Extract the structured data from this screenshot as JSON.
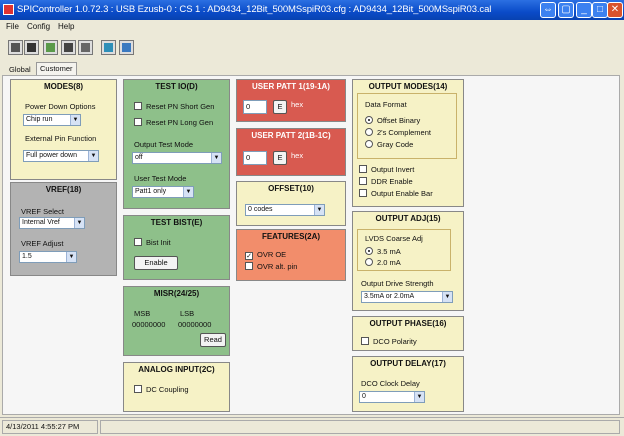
{
  "window": {
    "title": "SPIController 1.0.72.3 : USB Ezusb-0 : CS 1 : AD9434_12Bit_500MSspiR03.cfg : AD9434_12Bit_500MSspiR03.cal"
  },
  "menu": {
    "file": "File",
    "config": "Config",
    "help": "Help"
  },
  "tabs": {
    "global": "Global",
    "customer": "Customer"
  },
  "modes": {
    "title": "MODES(8)",
    "power_down_label": "Power Down Options",
    "power_down_value": "Chip run",
    "ext_pin_label": "External Pin Function",
    "ext_pin_value": "Full power down"
  },
  "vref": {
    "title": "VREF(18)",
    "select_label": "VREF Select",
    "select_value": "Internal Vref",
    "adjust_label": "VREF Adjust",
    "adjust_value": "1.5"
  },
  "test_io": {
    "title": "TEST IO(D)",
    "reset_short": "Reset PN Short Gen",
    "reset_long": "Reset PN Long Gen",
    "output_mode_label": "Output Test Mode",
    "output_mode_value": "off",
    "user_mode_label": "User Test Mode",
    "user_mode_value": "Patt1 only"
  },
  "test_bist": {
    "title": "TEST BIST(E)",
    "bist_init": "Bist Init",
    "enable": "Enable"
  },
  "misr": {
    "title": "MISR(24/25)",
    "msb_label": "MSB",
    "lsb_label": "LSB",
    "msb_value": "00000000",
    "lsb_value": "00000000",
    "read": "Read"
  },
  "analog_input": {
    "title": "ANALOG INPUT(2C)",
    "dc_coupling": "DC Coupling"
  },
  "user_patt1": {
    "title": "USER PATT 1(19-1A)",
    "value": "0",
    "e_btn": "E",
    "unit": "hex"
  },
  "user_patt2": {
    "title": "USER PATT 2(1B-1C)",
    "value": "0",
    "e_btn": "E",
    "unit": "hex"
  },
  "offset": {
    "title": "OFFSET(10)",
    "value": "0 codes"
  },
  "features": {
    "title": "FEATURES(2A)",
    "ovr_oe": "OVR OE",
    "ovr_alt": "OVR alt. pin"
  },
  "output_modes": {
    "title": "OUTPUT MODES(14)",
    "data_format_label": "Data Format",
    "offset_binary": "Offset Binary",
    "twos_complement": "2's Complement",
    "gray_code": "Gray Code",
    "output_invert": "Output Invert",
    "ddr_enable": "DDR Enable",
    "output_enable_bar": "Output Enable Bar"
  },
  "output_adj": {
    "title": "OUTPUT ADJ(15)",
    "lvds_label": "LVDS Coarse Adj",
    "opt_35": "3.5 mA",
    "opt_20": "2.0 mA",
    "drive_label": "Output Drive Strength",
    "drive_value": "3.5mA or 2.0mA"
  },
  "output_phase": {
    "title": "OUTPUT PHASE(16)",
    "dco_polarity": "DCO Polarity"
  },
  "output_delay": {
    "title": "OUTPUT DELAY(17)",
    "dco_delay_label": "DCO Clock Delay",
    "dco_delay_value": "0"
  },
  "status": {
    "timestamp": "4/13/2011 4:55:27 PM"
  },
  "colors": {
    "modes_bg": "#f6f2c6",
    "vref_bg": "#b3b3b3",
    "testio_bg": "#8ec08a",
    "user_patt_bg": "#d85a50",
    "offset_bg": "#f6f2c6",
    "features_bg": "#f28d6b",
    "output_bg": "#f6f2c6",
    "misr_bg": "#8ec08a"
  }
}
